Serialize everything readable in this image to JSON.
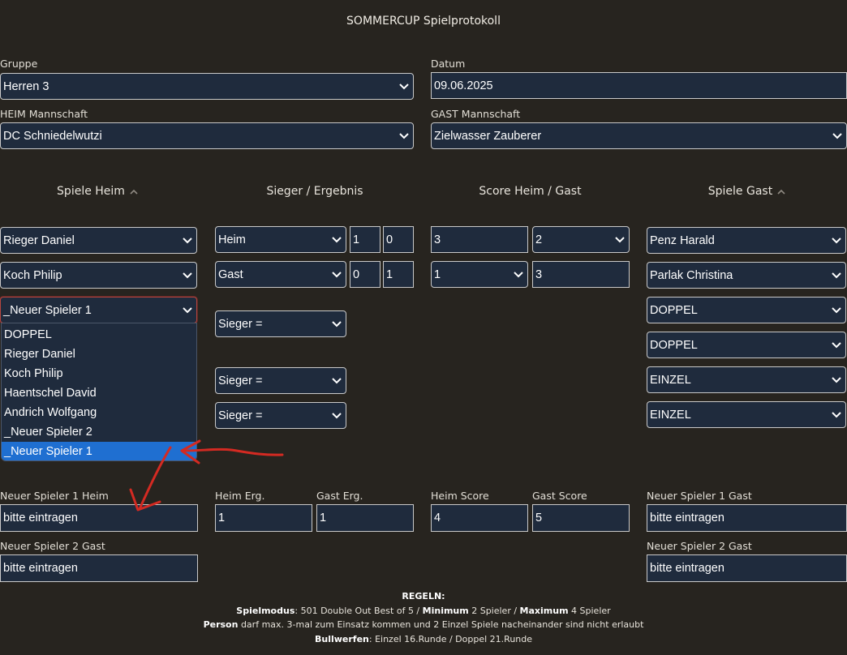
{
  "title": "SOMMERCUP Spielprotokoll",
  "form": {
    "gruppe_label": "Gruppe",
    "gruppe_value": "Herren 3",
    "datum_label": "Datum",
    "datum_value": "09.06.2025",
    "heim_label": "HEIM Mannschaft",
    "heim_value": "DC Schniedelwutzi",
    "gast_label": "GAST Mannschaft",
    "gast_value": "Zielwasser Zauberer"
  },
  "columns": {
    "spiele_heim": "Spiele Heim",
    "sieger": "Sieger / Ergebnis",
    "score": "Score Heim / Gast",
    "spiele_gast": "Spiele Gast"
  },
  "rows": [
    {
      "heim": "Rieger Daniel",
      "sieger": "Heim",
      "erg_heim": "1",
      "erg_gast": "0",
      "score_heim": "3",
      "score_gast": "2",
      "gast": "Penz Harald"
    },
    {
      "heim": "Koch Philip",
      "sieger": "Gast",
      "erg_heim": "0",
      "erg_gast": "1",
      "score_heim": "1",
      "score_gast": "3",
      "gast": "Parlak Christina"
    },
    {
      "heim": "_Neuer Spieler 1",
      "sieger": "Sieger =",
      "gast": "DOPPEL"
    },
    {
      "gast": "DOPPEL"
    },
    {
      "sieger": "Sieger =",
      "gast": "EINZEL"
    },
    {
      "sieger": "Sieger =",
      "gast": "EINZEL"
    }
  ],
  "dropdown_options": [
    "DOPPEL",
    "Rieger Daniel",
    "Koch Philip",
    "Haentschel David",
    "Andrich Wolfgang",
    "_Neuer Spieler 2",
    "_Neuer Spieler 1"
  ],
  "bottom": {
    "ns1_heim_label": "Neuer Spieler 1 Heim",
    "ns1_heim_value": "bitte eintragen",
    "heim_erg_label": "Heim Erg.",
    "heim_erg_value": "1",
    "gast_erg_label": "Gast Erg.",
    "gast_erg_value": "1",
    "heim_score_label": "Heim Score",
    "heim_score_value": "4",
    "gast_score_label": "Gast Score",
    "gast_score_value": "5",
    "ns1_gast_label": "Neuer Spieler 1 Gast",
    "ns1_gast_value": "bitte eintragen",
    "ns2_gast_left_label": "Neuer Spieler 2 Gast",
    "ns2_gast_left_value": "bitte eintragen",
    "ns2_gast_right_label": "Neuer Spieler 2 Gast",
    "ns2_gast_right_value": "bitte eintragen"
  },
  "rules": {
    "heading": "REGELN:",
    "l1_b1": "Spielmodus",
    "l1_t1": ": 501 Double Out Best of 5 / ",
    "l1_b2": "Minimum",
    "l1_t2": " 2 Spieler / ",
    "l1_b3": "Maximum",
    "l1_t3": " 4 Spieler",
    "l2_b1": "Person",
    "l2_t1": " darf max. 3-mal zum Einsatz kommen und 2 Einzel Spiele nacheinander sind nicht erlaubt",
    "l3_b1": "Bullwerfen",
    "l3_t1": ": Einzel 16.Runde / Doppel 21.Runde"
  },
  "colors": {
    "background": "#27241f",
    "field": "#1f2b3d",
    "highlight": "#1f6fd1",
    "annotation": "#d42a22"
  }
}
